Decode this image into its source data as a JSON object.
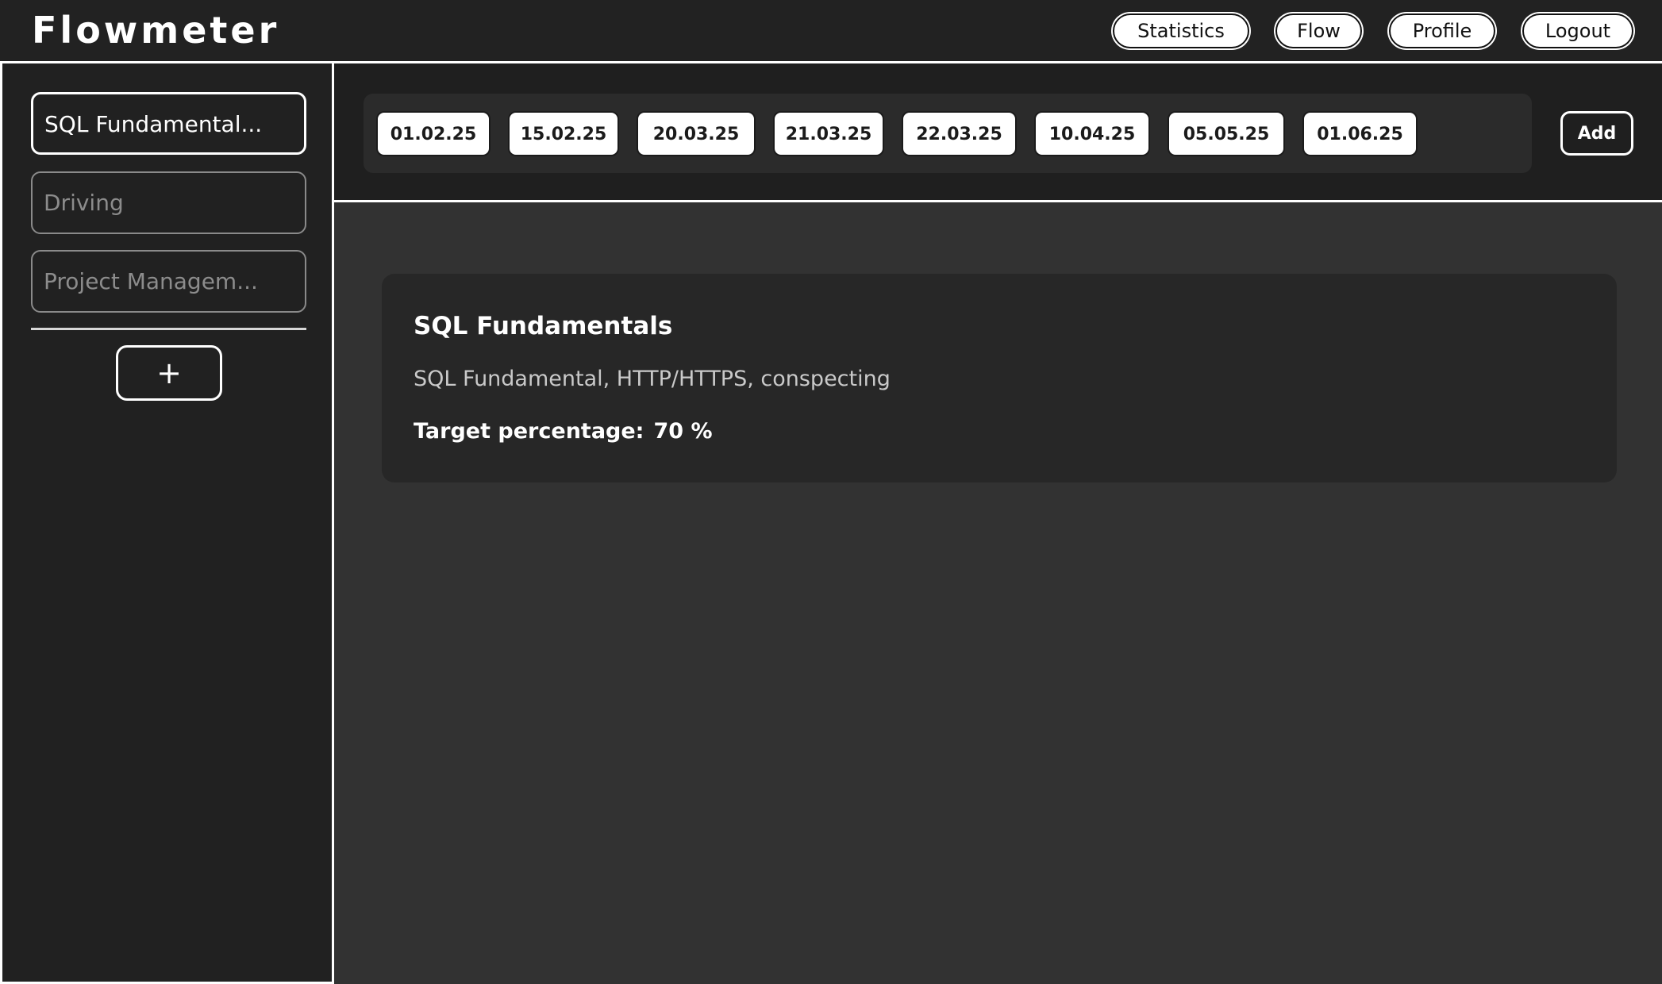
{
  "app": {
    "logo": "Flowmeter"
  },
  "nav": {
    "statistics": "Statistics",
    "flow": "Flow",
    "profile": "Profile",
    "logout": "Logout"
  },
  "sidebar": {
    "items": [
      {
        "label": "SQL Fundamental...",
        "active": true
      },
      {
        "label": "Driving",
        "active": false
      },
      {
        "label": "Project Managem...",
        "active": false
      }
    ],
    "add_label": "+"
  },
  "dates": {
    "items": [
      "01.02.25",
      "15.02.25",
      "20.03.25",
      "21.03.25",
      "22.03.25",
      "10.04.25",
      "05.05.25",
      "01.06.25"
    ],
    "add_label": "Add"
  },
  "card": {
    "title": "SQL Fundamentals",
    "description": "SQL Fundamental, HTTP/HTTPS, conspecting",
    "target_label": "Target percentage:",
    "target_value": "70 %"
  },
  "colors": {
    "header_bg": "#222222",
    "sidebar_bg": "#212121",
    "main_bg": "#323232",
    "card_bg": "#272727",
    "accent": "#ffffff"
  }
}
